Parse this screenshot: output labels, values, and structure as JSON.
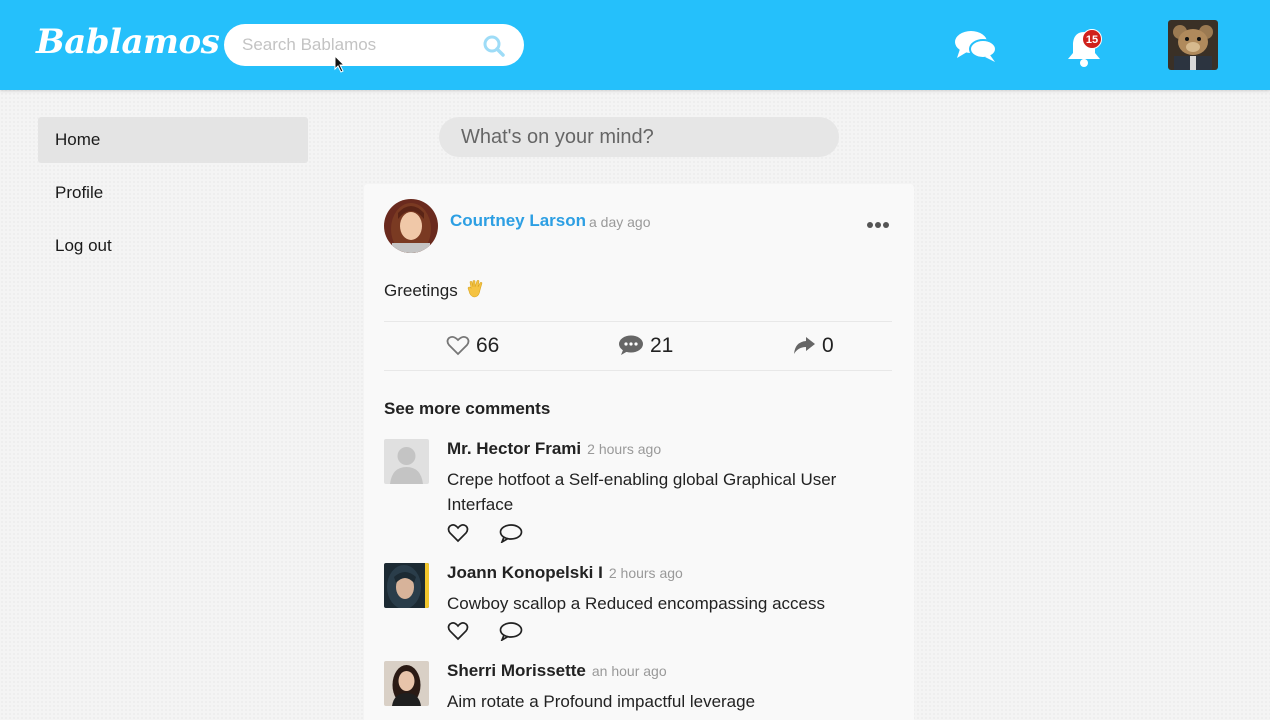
{
  "header": {
    "logo": "Bablamos",
    "search_placeholder": "Search Bablamos",
    "notification_count": "15",
    "brand_color": "#25c0fb"
  },
  "sidebar": {
    "items": [
      {
        "label": "Home",
        "active": true
      },
      {
        "label": "Profile",
        "active": false
      },
      {
        "label": "Log out",
        "active": false
      }
    ]
  },
  "composer": {
    "placeholder": "What's on your mind?"
  },
  "post": {
    "author": "Courtney Larson",
    "time": "a day ago",
    "text": "Greetings",
    "likes": "66",
    "comments": "21",
    "shares": "0",
    "see_more": "See more comments"
  },
  "comments": [
    {
      "author": "Mr. Hector Frami",
      "time": "2 hours ago",
      "text": "Crepe hotfoot a Self-enabling global Graphical User Interface"
    },
    {
      "author": "Joann Konopelski I",
      "time": "2 hours ago",
      "text": "Cowboy scallop a Reduced encompassing access"
    },
    {
      "author": "Sherri Morissette",
      "time": "an hour ago",
      "text": "Aim rotate a Profound impactful leverage"
    }
  ]
}
